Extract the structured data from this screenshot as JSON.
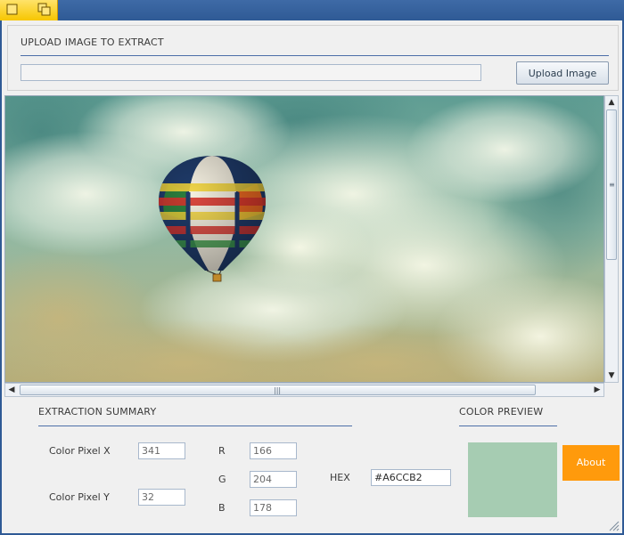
{
  "upload": {
    "section_title": "UPLOAD IMAGE TO EXTRACT",
    "path_value": "",
    "button_label": "Upload Image"
  },
  "summary": {
    "section_title": "EXTRACTION SUMMARY",
    "pixel_x_label": "Color Pixel  X",
    "pixel_x_value": "341",
    "pixel_y_label": "Color Pixel  Y",
    "pixel_y_value": "32",
    "r_label": "R",
    "r_value": "166",
    "g_label": "G",
    "g_value": "204",
    "b_label": "B",
    "b_value": "178",
    "hex_label": "HEX",
    "hex_value": "#A6CCB2"
  },
  "preview": {
    "section_title": "COLOR PREVIEW",
    "swatch_color": "#A6CCB2"
  },
  "about_label": "About",
  "colors": {
    "titlebar": "#2f5a95",
    "accent_yellow": "#f7c600",
    "about_orange": "#ff9a0c",
    "rule_blue": "#4c6ea8"
  },
  "icons": {
    "minimize": "square-icon",
    "restore": "overlapped-squares-icon",
    "scroll_up": "triangle-up-icon",
    "scroll_down": "triangle-down-icon",
    "scroll_left": "triangle-left-icon",
    "scroll_right": "triangle-right-icon"
  },
  "image": {
    "subject": "hot-air-balloon-in-cloudy-sky"
  }
}
